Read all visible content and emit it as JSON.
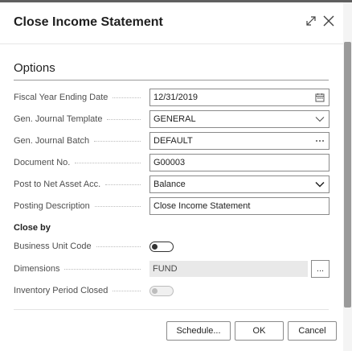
{
  "dialog": {
    "title": "Close Income Statement",
    "expand_icon": "expand-diagonal-icon",
    "close_icon": "close-icon"
  },
  "options": {
    "section_title": "Options",
    "fields": [
      {
        "label": "Fiscal Year Ending Date",
        "value": "12/31/2019",
        "adornment": "calendar-icon"
      },
      {
        "label": "Gen. Journal Template",
        "value": "GENERAL",
        "adornment": "chevron-down-icon"
      },
      {
        "label": "Gen. Journal Batch",
        "value": "DEFAULT",
        "adornment": "ellipsis-icon"
      },
      {
        "label": "Document No.",
        "value": "G00003"
      },
      {
        "label": "Post to Net Asset Acc.",
        "value": "Balance",
        "adornment": "chevron-down-icon"
      },
      {
        "label": "Posting Description",
        "value": "Close Income Statement"
      }
    ]
  },
  "close_by": {
    "subhead": "Close by",
    "business_unit_code": {
      "label": "Business Unit Code",
      "enabled": false
    },
    "dimensions": {
      "label": "Dimensions",
      "value": "FUND",
      "assist": "..."
    },
    "inventory_period_closed": {
      "label": "Inventory Period Closed",
      "enabled": false,
      "disabled": true
    }
  },
  "footer": {
    "schedule_label": "Schedule...",
    "ok_label": "OK",
    "cancel_label": "Cancel"
  },
  "colors": {
    "dialog_bg": "#ffffff",
    "backdrop": "#5f5f5f",
    "border": "#8a8a8a",
    "label": "#4f4f4f"
  }
}
